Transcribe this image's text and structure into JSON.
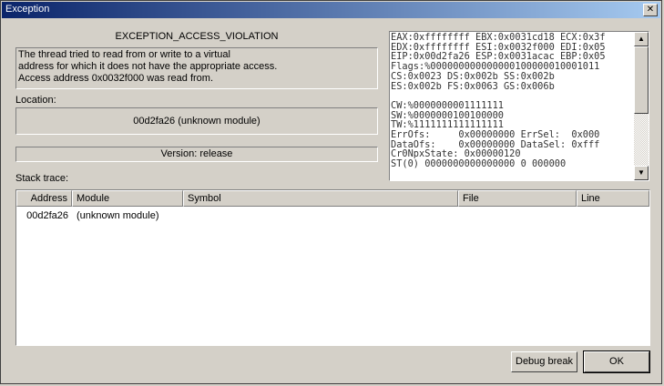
{
  "window": {
    "title": "Exception",
    "close_glyph": "✕"
  },
  "exception_name": "EXCEPTION_ACCESS_VIOLATION",
  "description": "The thread tried to read from or write to a virtual\naddress for which it does not have the appropriate access.\nAccess address 0x0032f000 was read from.",
  "location": {
    "label": "Location:",
    "value": "00d2fa26 (unknown module)"
  },
  "version": "Version: release",
  "registers": "EAX:0xffffffff EBX:0x0031cd18 ECX:0x3f\nEDX:0xffffffff ESI:0x0032f000 EDI:0x05\nEIP:0x00d2fa26 ESP:0x0031acac EBP:0x05\nFlags:%000000000000000100000010001011\nCS:0x0023 DS:0x002b SS:0x002b\nES:0x002b FS:0x0063 GS:0x006b\n\nCW:%0000000001111111\nSW:%0000000100100000\nTW:%1111111111111111\nErrOfs:     0x00000000 ErrSel:  0x000\nDataOfs:    0x00000000 DataSel: 0xfff\nCr0NpxState: 0x00000120\nST(0) 0000000000000000 0 000000",
  "stack_trace": {
    "label": "Stack trace:",
    "columns": [
      "Address",
      "Module",
      "Symbol",
      "File",
      "Line"
    ],
    "rows": [
      {
        "address": "00d2fa26",
        "module": "(unknown module)",
        "symbol": "",
        "file": "",
        "line": ""
      }
    ]
  },
  "buttons": {
    "debug_break": "Debug break",
    "ok": "OK"
  },
  "icons": {
    "scroll_up": "▲",
    "scroll_down": "▼"
  }
}
